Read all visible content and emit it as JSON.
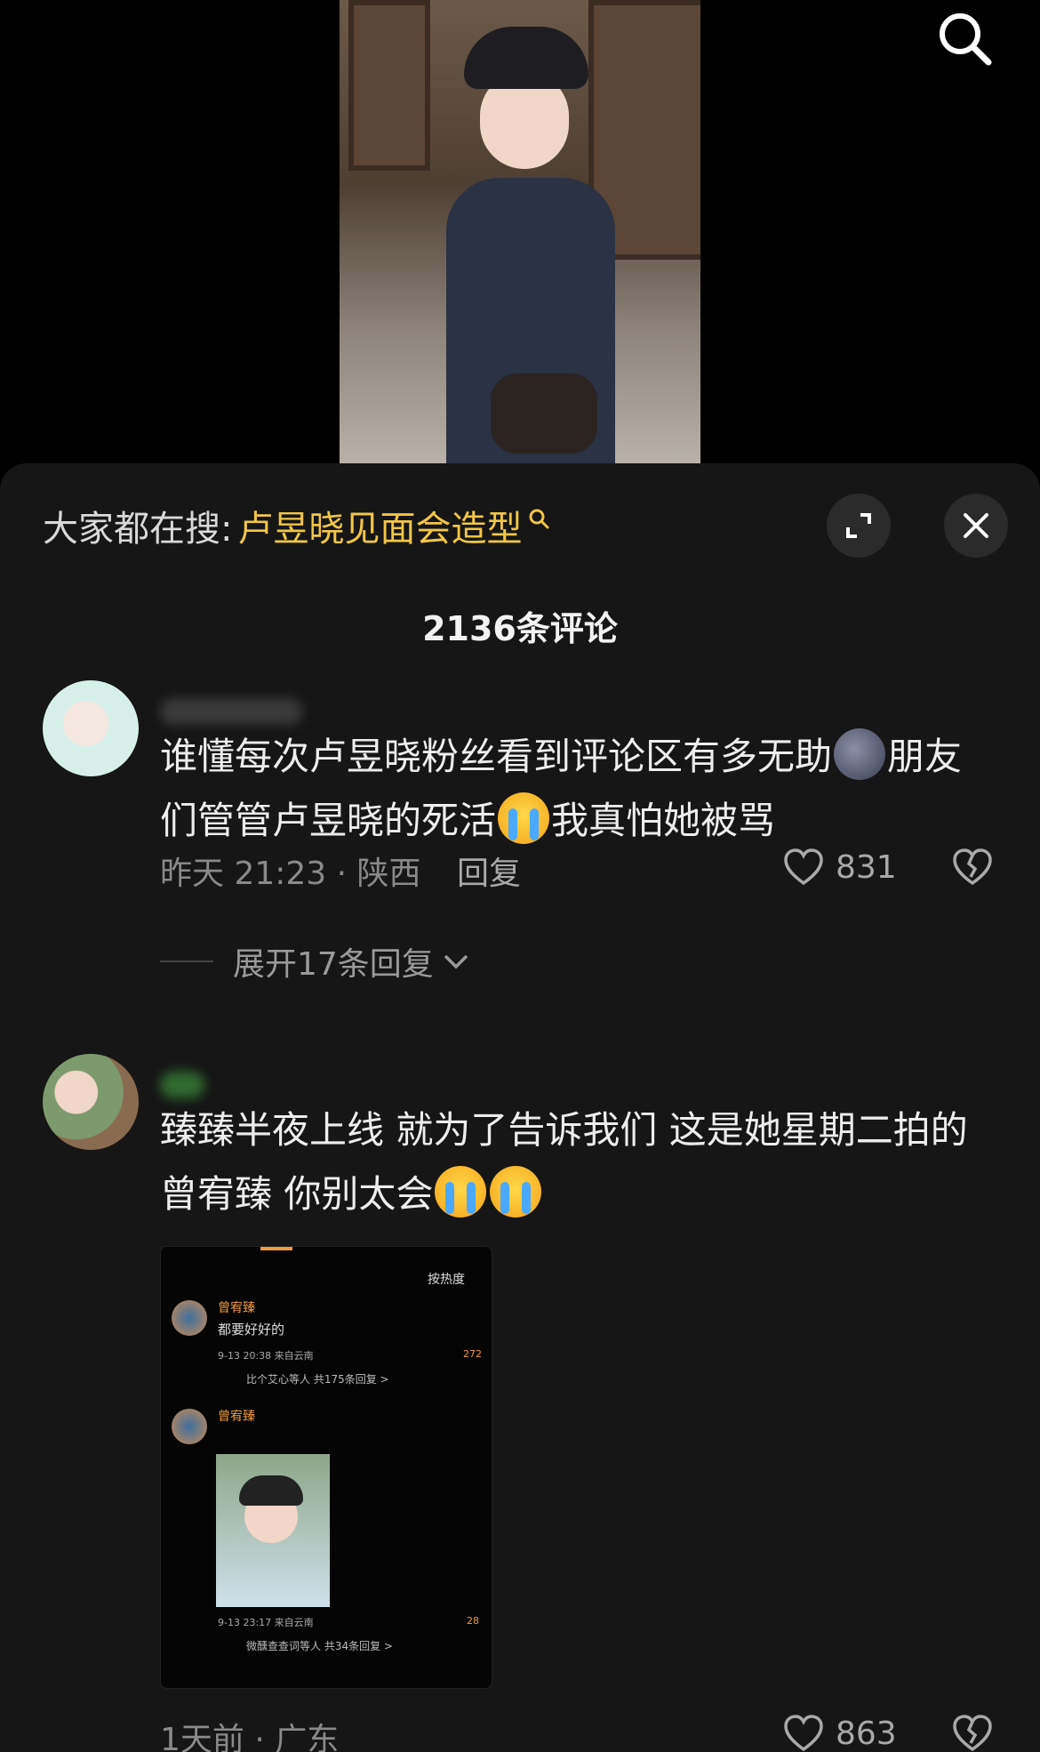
{
  "search_bar": {
    "prefix": "大家都在搜:",
    "term": "卢昱晓见面会造型"
  },
  "comment_count": "2136条评论",
  "comments": [
    {
      "text_part1": "谁懂每次卢昱晓粉丝看到评论区有多无助",
      "text_part2": "朋友们管管卢昱晓的死活",
      "text_part3": "我真怕她被骂",
      "time_location": "昨天 21:23 · 陕西",
      "reply_label": "回复",
      "likes": "831",
      "expand_replies": "展开17条回复"
    },
    {
      "text_part1": "臻臻半夜上线 就为了告诉我们 这是她星期二拍的 曾宥臻 你别太会",
      "time_location": "1天前 · 广东",
      "likes": "863",
      "attached_image": {
        "sort_label": "按热度",
        "entry1_name": "曾宥臻",
        "entry1_text": "都要好好的",
        "entry1_meta": "9-13 20:38 来自云南",
        "entry1_likes": "272",
        "entry1_replies": "比个艾心等人  共175条回复 >",
        "entry2_name": "曾宥臻",
        "entry2_meta": "9-13 23:17 来自云南",
        "entry2_likes": "28",
        "entry2_replies": "微醺查查词等人  共34条回复 >"
      }
    }
  ]
}
